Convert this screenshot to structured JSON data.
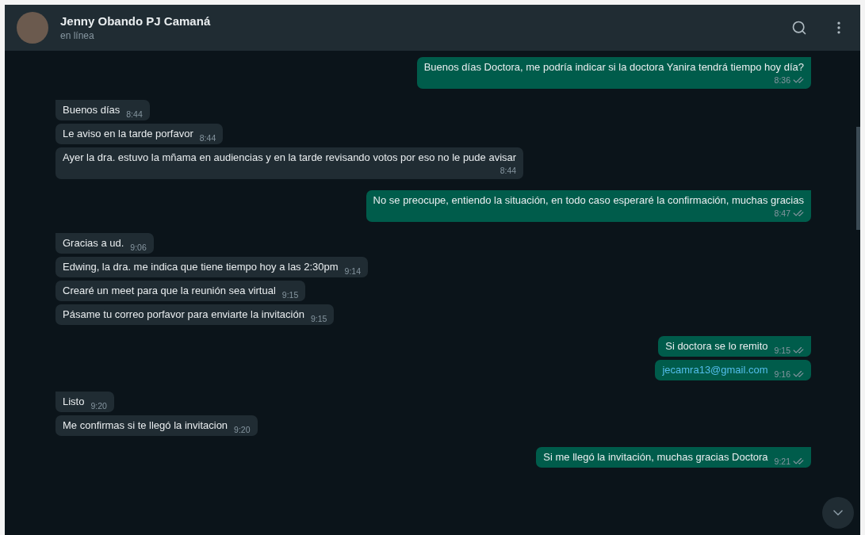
{
  "header": {
    "name": "Jenny Obando PJ Camaná",
    "status": "en línea"
  },
  "messages": [
    {
      "kind": "sent",
      "text": "Buenos días Doctora, me podría indicar si la doctora Yanira tendrá tiempo hoy día?",
      "time": "8:36",
      "first_in_group": true,
      "is_link": false
    },
    {
      "kind": "received",
      "text": "Buenos días",
      "time": "8:44",
      "first_in_group": true,
      "is_link": false
    },
    {
      "kind": "received",
      "text": "Le aviso en la tarde porfavor",
      "time": "8:44",
      "first_in_group": false,
      "is_link": false
    },
    {
      "kind": "received",
      "text": "Ayer la dra. estuvo la mñama en audiencias y en la tarde revisando votos por eso no le pude avisar",
      "time": "8:44",
      "first_in_group": false,
      "is_link": false
    },
    {
      "kind": "sent",
      "text": "No se preocupe, entiendo la situación, en todo caso esperaré la confirmación, muchas gracias",
      "time": "8:47",
      "first_in_group": true,
      "is_link": false
    },
    {
      "kind": "received",
      "text": "Gracias a ud.",
      "time": "9:06",
      "first_in_group": true,
      "is_link": false
    },
    {
      "kind": "received",
      "text": "Edwing, la dra. me indica que tiene tiempo hoy a las 2:30pm",
      "time": "9:14",
      "first_in_group": false,
      "is_link": false
    },
    {
      "kind": "received",
      "text": "Crearé un meet para que la reunión sea virtual",
      "time": "9:15",
      "first_in_group": false,
      "is_link": false
    },
    {
      "kind": "received",
      "text": "Pásame tu correo porfavor para enviarte la invitación",
      "time": "9:15",
      "first_in_group": false,
      "is_link": false
    },
    {
      "kind": "sent",
      "text": "Si doctora se lo remito",
      "time": "9:15",
      "first_in_group": true,
      "is_link": false
    },
    {
      "kind": "sent",
      "text": "jecamra13@gmail.com",
      "time": "9:16",
      "first_in_group": false,
      "is_link": true
    },
    {
      "kind": "received",
      "text": "Listo",
      "time": "9:20",
      "first_in_group": true,
      "is_link": false
    },
    {
      "kind": "received",
      "text": "Me confirmas si te llegó la invitacion",
      "time": "9:20",
      "first_in_group": false,
      "is_link": false
    },
    {
      "kind": "sent",
      "text": "Si me llegó la invitación, muchas gracias Doctora",
      "time": "9:21",
      "first_in_group": true,
      "is_link": false
    }
  ]
}
